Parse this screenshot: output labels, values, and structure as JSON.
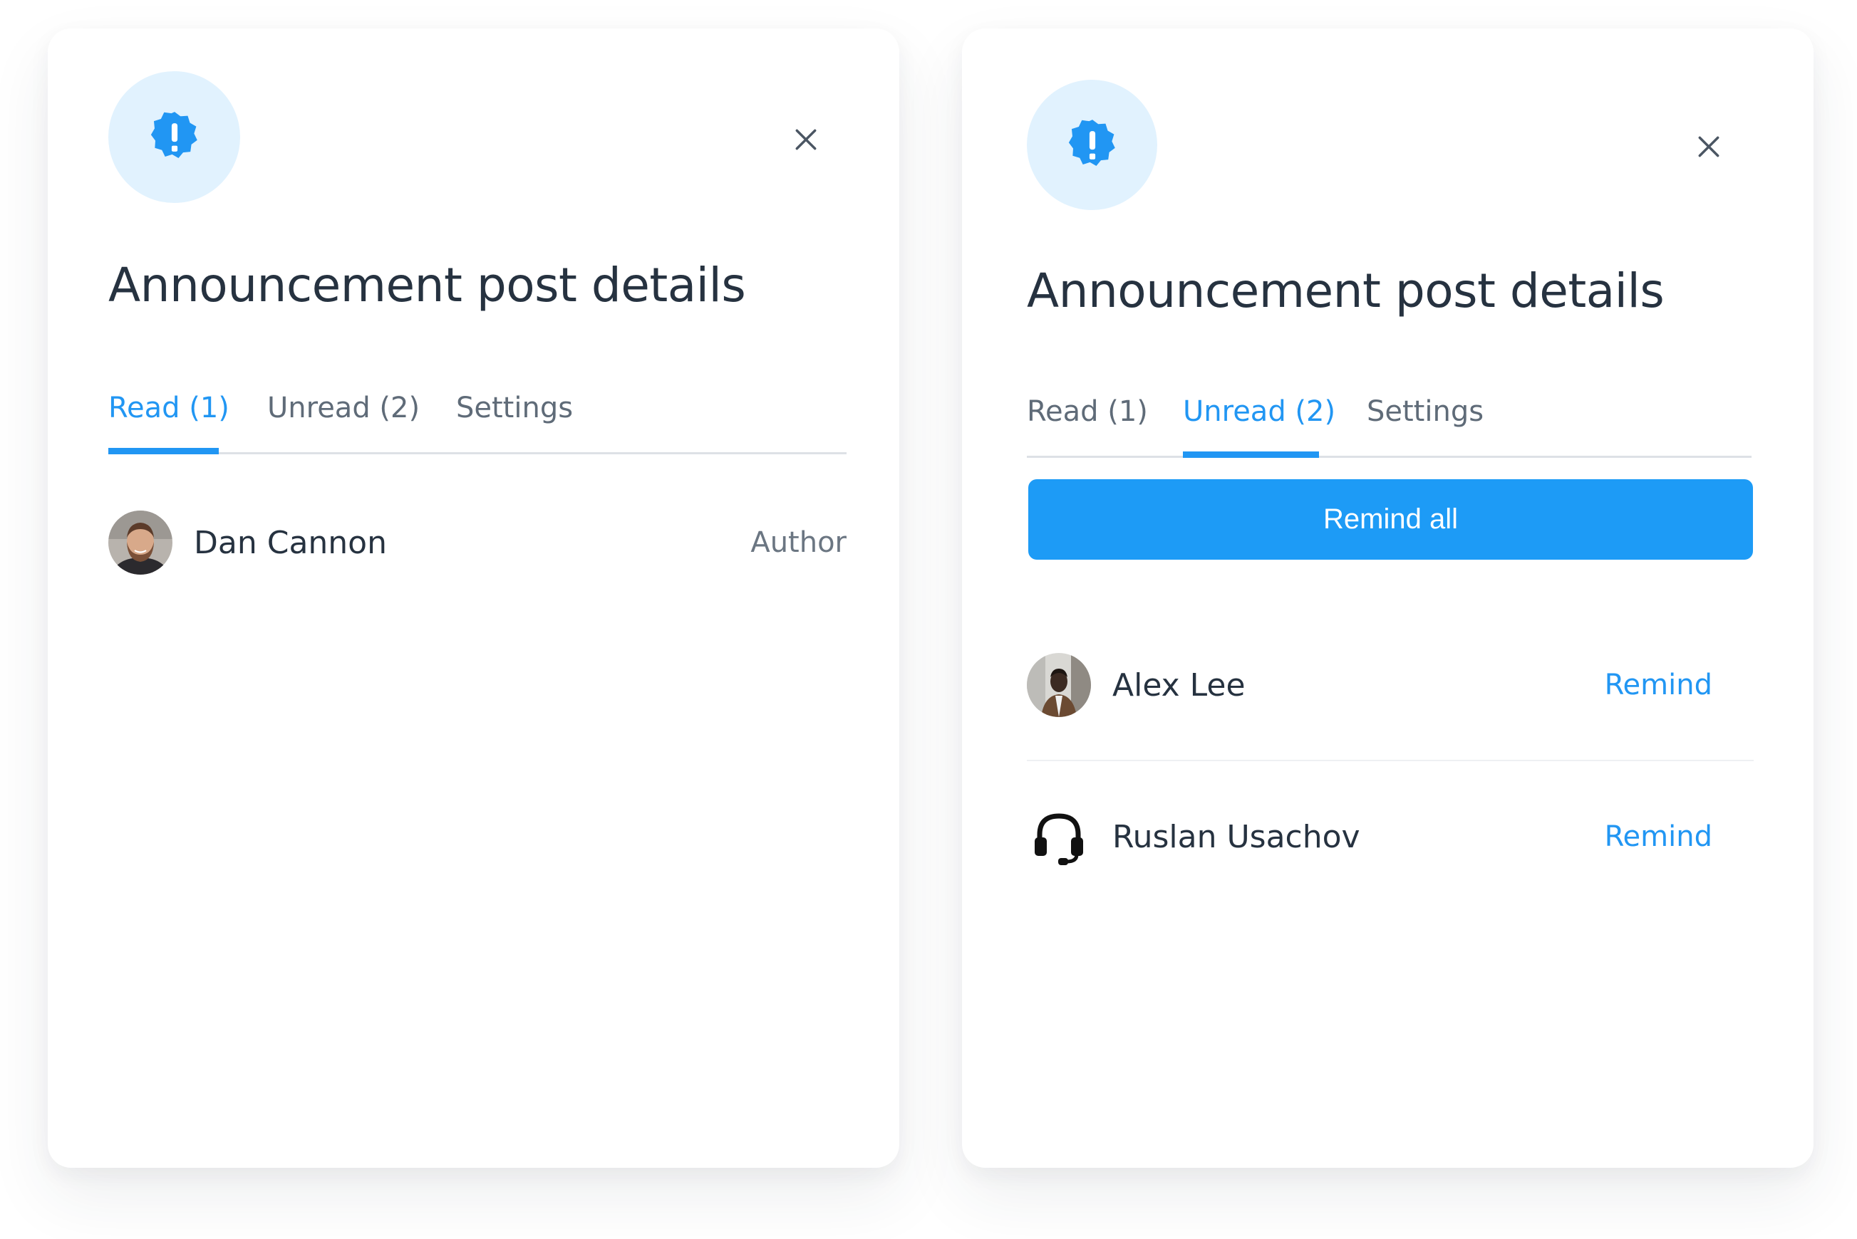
{
  "accent_color": "#2196f3",
  "panels": [
    {
      "icon": "alert-badge-icon",
      "title": "Announcement post details",
      "tabs": [
        {
          "label": "Read (1)",
          "active": true
        },
        {
          "label": "Unread (2)",
          "active": false
        },
        {
          "label": "Settings",
          "active": false
        }
      ],
      "rows": [
        {
          "name": "Dan Cannon",
          "meta": "Author",
          "avatar": "user-photo-icon"
        }
      ]
    },
    {
      "icon": "alert-badge-icon",
      "title": "Announcement post details",
      "tabs": [
        {
          "label": "Read (1)",
          "active": false
        },
        {
          "label": "Unread (2)",
          "active": true
        },
        {
          "label": "Settings",
          "active": false
        }
      ],
      "remind_all_label": "Remind all",
      "rows": [
        {
          "name": "Alex Lee",
          "action": "Remind",
          "avatar": "user-photo-icon"
        },
        {
          "name": "Ruslan Usachov",
          "action": "Remind",
          "avatar": "headset-icon"
        }
      ]
    }
  ]
}
